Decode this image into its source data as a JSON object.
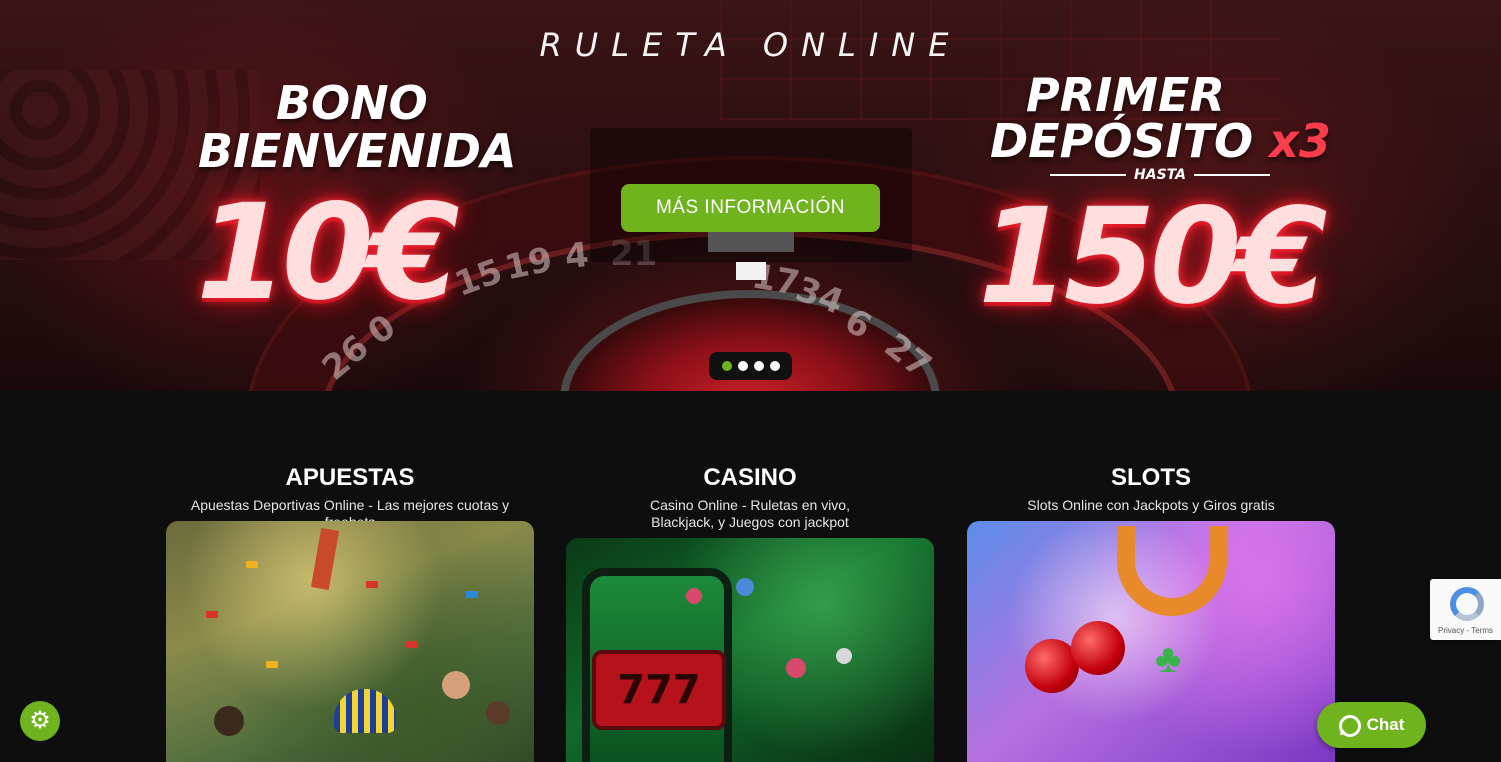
{
  "hero": {
    "title": "RULETA ONLINE",
    "left_promo": {
      "line1": "BONO",
      "line2": "BIENVENIDA",
      "amount": "10€"
    },
    "right_promo": {
      "line1": "PRIMER",
      "line2": "DEPÓSITO",
      "multiplier": "x3",
      "hasta": "HASTA",
      "amount": "150€"
    },
    "cta_label": "MÁS INFORMACIÓN",
    "wheel_numbers": [
      "15",
      "19",
      "4",
      "21",
      "0",
      "26",
      "34",
      "6",
      "27",
      "17"
    ],
    "slider": {
      "count": 4,
      "active_index": 0
    }
  },
  "categories": [
    {
      "title": "APUESTAS",
      "subtitle": "Apuestas Deportivas Online - Las mejores cuotas y freebets"
    },
    {
      "title": "CASINO",
      "subtitle_line1": "Casino Online - Ruletas en vivo,",
      "subtitle_line2": "Blackjack, y Juegos con jackpot",
      "reel_text": "777"
    },
    {
      "title": "SLOTS",
      "subtitle": "Slots Online con Jackpots y Giros gratis"
    }
  ],
  "recaptcha": {
    "links": "Privacy - Terms"
  },
  "chat": {
    "label": "Chat"
  },
  "settings": {
    "icon": "gear-icon"
  },
  "colors": {
    "accent_green": "#6fb31e",
    "background": "#0e0e0e",
    "promo_red": "#e0101e"
  }
}
